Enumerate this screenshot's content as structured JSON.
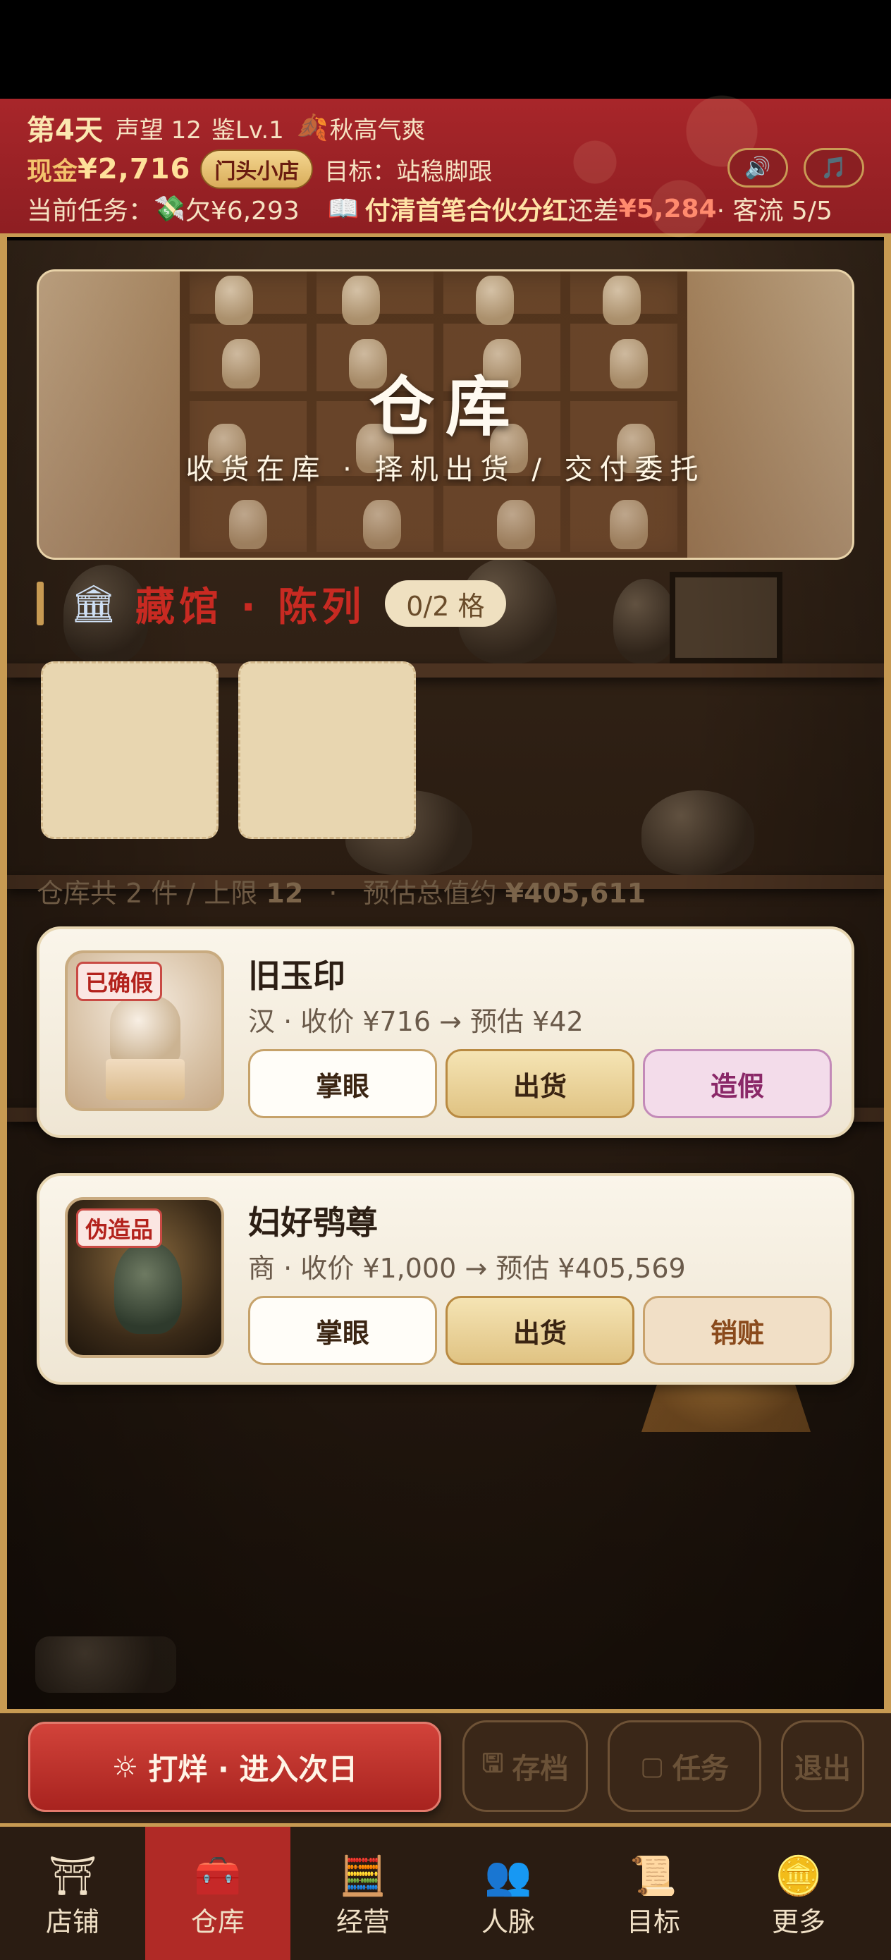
{
  "header": {
    "day": "第4天",
    "reputation": "声望 12",
    "appraisal_level": "鉴Lv.1",
    "season_icon": "maple-leaf-icon",
    "season": "秋高气爽",
    "cash_label": "现金",
    "cash_value": "¥2,716",
    "shop_badge": "门头小店",
    "goal": "目标：站稳脚跟",
    "sound_icon": "speaker-icon",
    "music_icon": "music-note-icon",
    "task_label": "当前任务：",
    "debt_icon": "money-wings-icon",
    "debt": "欠¥6,293",
    "task_icon": "open-book-icon",
    "task_title": "付清首笔合伙分红",
    "task_remain_label": "还差",
    "task_remain_value": "¥5,284",
    "traffic": "· 客流 5/5"
  },
  "banner": {
    "title": "仓库",
    "subtitle": "收货在库 · 择机出货 / 交付委托"
  },
  "museum": {
    "icon": "museum-icon",
    "title": "藏馆 · 陈列",
    "slots": "0/2 格"
  },
  "summary": {
    "count_text": "仓库共 2 件 / 上限 ",
    "limit": "12",
    "sep": "·",
    "value_label": "预估总值约 ",
    "value": "¥405,611"
  },
  "items": [
    {
      "tag": "已确假",
      "name": "旧玉印",
      "desc": "汉 · 收价 ¥716 → 预估 ¥42",
      "btn_eye": "掌眼",
      "btn_sell": "出货",
      "btn_third": "造假"
    },
    {
      "tag": "伪造品",
      "name": "妇好鸮尊",
      "desc": "商 · 收价 ¥1,000 → 预估 ¥405,569",
      "btn_eye": "掌眼",
      "btn_sell": "出货",
      "btn_third": "销赃"
    }
  ],
  "actions": {
    "next_day_icon": "sun-icon",
    "next_day": "打烊 · 进入次日",
    "save_icon": "save-icon",
    "save": "存档",
    "task_icon": "chat-icon",
    "task": "任务",
    "exit": "退出"
  },
  "tabs": [
    {
      "label": "店铺",
      "icon": "shop-icon"
    },
    {
      "label": "仓库",
      "icon": "treasure-chest-icon",
      "active": true
    },
    {
      "label": "经营",
      "icon": "abacus-icon"
    },
    {
      "label": "人脉",
      "icon": "people-icon"
    },
    {
      "label": "目标",
      "icon": "scroll-icon"
    },
    {
      "label": "更多",
      "icon": "stacked-coins-icon"
    }
  ],
  "colors": {
    "header_red": "#a8262a",
    "gold": "#c79a52",
    "accent_red": "#c82a22"
  }
}
